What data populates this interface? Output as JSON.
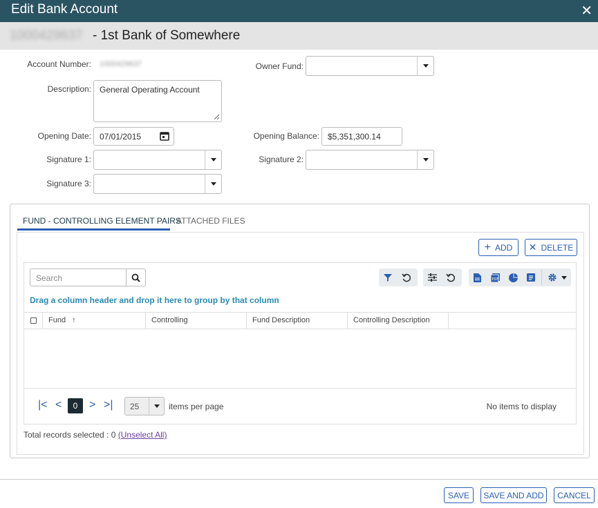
{
  "dialog": {
    "title": "Edit Bank Account"
  },
  "header": {
    "account_number_masked": "1000429637",
    "bank_name": "- 1st Bank of Somewhere"
  },
  "form": {
    "account_number_label": "Account Number:",
    "account_number_value": "1000429637",
    "owner_fund_label": "Owner Fund:",
    "owner_fund_value": "",
    "description_label": "Description:",
    "description_value": "General Operating Account",
    "opening_date_label": "Opening Date:",
    "opening_date_value": "07/01/2015",
    "opening_balance_label": "Opening Balance:",
    "opening_balance_value": "$5,351,300.14",
    "signature1_label": "Signature 1:",
    "signature2_label": "Signature 2:",
    "signature3_label": "Signature 3:"
  },
  "tabs": [
    {
      "label": "FUND - CONTROLLING ELEMENT PAIRS",
      "active": true
    },
    {
      "label": "ATTACHED FILES",
      "active": false
    }
  ],
  "actions": {
    "add_label": "ADD",
    "delete_label": "DELETE"
  },
  "grid": {
    "search_placeholder": "Search",
    "group_hint": "Drag a column header and drop it here to group by that column",
    "columns": [
      "Fund",
      "Controlling",
      "Fund Description",
      "Controlling Description"
    ],
    "sort_indicator": "↑",
    "page": "0",
    "page_size": "25",
    "items_per_page_label": "items per page",
    "empty_text": "No items to display"
  },
  "selection": {
    "total_text": "Total records selected : 0",
    "unselect_label": "(Unselect All)"
  },
  "footer": {
    "save_label": "SAVE",
    "save_add_label": "SAVE AND ADD",
    "cancel_label": "CANCEL"
  },
  "colors": {
    "titlebar": "#2b5463",
    "accent": "#2a5fb3",
    "hint": "#2a8ab0"
  },
  "icons": [
    "close-icon",
    "calendar-icon",
    "chevron-down-icon",
    "search-icon",
    "filter-icon",
    "reset-icon",
    "sliders-icon",
    "file-icon",
    "pdf-icon",
    "pie-chart-icon",
    "list-icon",
    "gear-icon",
    "plus-icon",
    "x-icon",
    "first-page-icon",
    "prev-page-icon",
    "next-page-icon",
    "last-page-icon"
  ]
}
